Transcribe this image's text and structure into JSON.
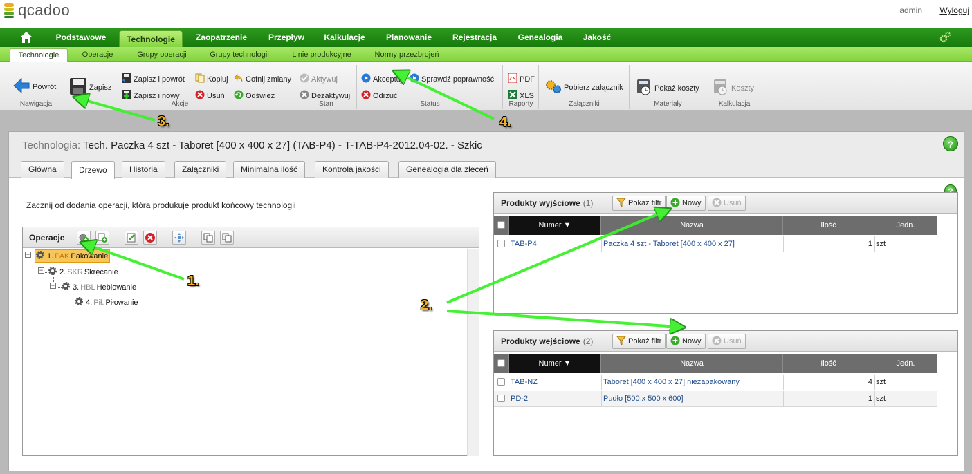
{
  "header": {
    "logo_text": "qcadoo",
    "user": "admin",
    "logout": "Wyloguj"
  },
  "main_nav": [
    "Podstawowe",
    "Technologie",
    "Zaopatrzenie",
    "Przepływ",
    "Kalkulacje",
    "Planowanie",
    "Rejestracja",
    "Genealogia",
    "Jakość"
  ],
  "main_nav_active": "Technologie",
  "sub_nav": [
    "Technologie",
    "Operacje",
    "Grupy operacji",
    "Grupy technologii",
    "Linie produkcyjne",
    "Normy przezbrojeń"
  ],
  "sub_nav_active": "Technologie",
  "ribbon": {
    "nawigacja": {
      "title": "Nawigacja",
      "back": "Powrót"
    },
    "akcje": {
      "title": "Akcje",
      "save": "Zapisz",
      "save_back": "Zapisz i powrót",
      "save_new": "Zapisz i nowy",
      "copy": "Kopiuj",
      "delete": "Usuń",
      "undo": "Cofnij zmiany",
      "refresh": "Odśwież"
    },
    "stan": {
      "title": "Stan",
      "activate": "Aktywuj",
      "deactivate": "Dezaktywuj"
    },
    "status": {
      "title": "Status",
      "accept": "Akceptuj",
      "reject": "Odrzuć",
      "check": "Sprawdź poprawność"
    },
    "raporty": {
      "title": "Raporty",
      "pdf": "PDF",
      "xls": "XLS"
    },
    "zalaczniki": {
      "title": "Załączniki",
      "download": "Pobierz załącznik"
    },
    "materialy": {
      "title": "Materiały",
      "costs": "Pokaż koszty"
    },
    "kalkulacja": {
      "title": "Kalkulacja",
      "costs": "Koszty"
    }
  },
  "page": {
    "label": "Technologia:",
    "title": "Tech. Paczka 4 szt - Taboret [400 x 400 x 27] (TAB-P4) - T-TAB-P4-2012.04-02. - Szkic",
    "help": "?"
  },
  "tabs": [
    "Główna",
    "Drzewo",
    "Historia",
    "Załączniki",
    "Minimalna ilość",
    "Kontrola jakości",
    "Genealogia dla zleceń"
  ],
  "active_tab": "Drzewo",
  "intro": "Zacznij od dodania operacji, która produkuje produkt końcowy technologii",
  "operations": {
    "title": "Operacje",
    "nodes": [
      {
        "num": "1.",
        "code": "PAK",
        "name": "Pakowanie",
        "selected": true
      },
      {
        "num": "2.",
        "code": "SKR",
        "name": "Skręcanie",
        "selected": false
      },
      {
        "num": "3.",
        "code": "HBL",
        "name": "Heblowanie",
        "selected": false
      },
      {
        "num": "4.",
        "code": "Pił.",
        "name": "Piłowanie",
        "selected": false
      }
    ]
  },
  "grid_buttons": {
    "filter": "Pokaż filtr",
    "new": "Nowy",
    "delete": "Usuń"
  },
  "columns": {
    "number": "Numer",
    "name": "Nazwa",
    "qty": "Ilość",
    "unit": "Jedn."
  },
  "output_products": {
    "title": "Produkty wyjściowe",
    "count": "(1)",
    "rows": [
      {
        "number": "TAB-P4",
        "name": "Paczka 4 szt - Taboret [400 x 400 x 27]",
        "qty": "1",
        "unit": "szt"
      }
    ]
  },
  "input_products": {
    "title": "Produkty wejściowe",
    "count": "(2)",
    "rows": [
      {
        "number": "TAB-NZ",
        "name": "Taboret [400 x 400 x 27] niezapakowany",
        "qty": "4",
        "unit": "szt"
      },
      {
        "number": "PD-2",
        "name": "Pudło [500 x 500 x 600]",
        "qty": "1",
        "unit": "szt"
      }
    ]
  },
  "callouts": [
    "1.",
    "2.",
    "3.",
    "4."
  ],
  "colors": {
    "nav_green": "#2e9a1e",
    "subnav_green": "#a6e865",
    "arrow_green": "#2ee51e",
    "callout_orange": "#f6b21a",
    "selected_node": "#f7c65a"
  }
}
